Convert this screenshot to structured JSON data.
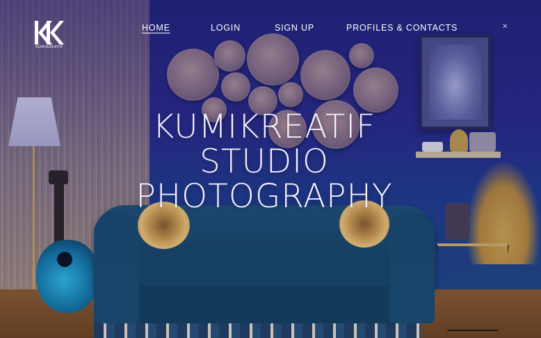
{
  "logo": {
    "text": "KUMIKREATIF",
    "icon": "kk-monogram-logo"
  },
  "nav": {
    "items": [
      {
        "label": "HOME",
        "active": true
      },
      {
        "label": "LOGIN",
        "active": false
      },
      {
        "label": "SIGN UP",
        "active": false
      },
      {
        "label": "PROFILES & CONTACTS",
        "active": false
      }
    ]
  },
  "hero": {
    "lines": [
      "KUMIKREATIF",
      "STUDIO",
      "PHOTOGRAPHY"
    ]
  },
  "colors": {
    "nav_text": "#ffffff",
    "hero_text": "#f4f0ff",
    "wall": "#23247a"
  }
}
